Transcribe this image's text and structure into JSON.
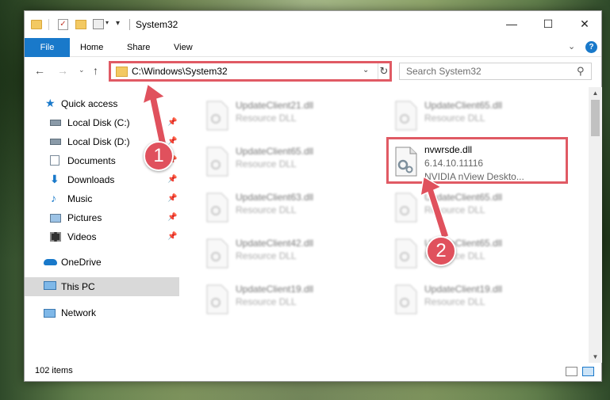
{
  "window": {
    "title": "System32",
    "minimize_glyph": "—",
    "maximize_glyph": "☐",
    "close_glyph": "✕"
  },
  "quick_access_toolbar": {
    "check_glyph": "✓",
    "caret_glyph": "▾",
    "drop_glyph": "▾"
  },
  "ribbon": {
    "tabs": [
      "File",
      "Home",
      "Share",
      "View"
    ],
    "collapse_glyph": "⌄",
    "help_glyph": "?"
  },
  "navigation": {
    "back_glyph": "←",
    "forward_glyph": "→",
    "recent_glyph": "⌄",
    "up_glyph": "↑",
    "address": "C:\\Windows\\System32",
    "address_dropdown_glyph": "⌄",
    "refresh_glyph": "↻",
    "search_placeholder": "Search System32",
    "search_glyph": "⚲"
  },
  "sidebar": {
    "pin_glyph": "📌",
    "items": [
      {
        "label": "Quick access",
        "icon": "star-icon",
        "pinned": false
      },
      {
        "label": "Local Disk (C:)",
        "icon": "drive-icon",
        "pinned": true
      },
      {
        "label": "Local Disk (D:)",
        "icon": "drive-icon",
        "pinned": true
      },
      {
        "label": "Documents",
        "icon": "documents-icon",
        "pinned": true
      },
      {
        "label": "Downloads",
        "icon": "download-icon",
        "pinned": true
      },
      {
        "label": "Music",
        "icon": "music-icon",
        "pinned": true
      },
      {
        "label": "Pictures",
        "icon": "pictures-icon",
        "pinned": true
      },
      {
        "label": "Videos",
        "icon": "videos-icon",
        "pinned": true
      },
      {
        "label": "OneDrive",
        "icon": "cloud-icon",
        "pinned": false
      },
      {
        "label": "This PC",
        "icon": "computer-icon",
        "pinned": false,
        "selected": true
      },
      {
        "label": "Network",
        "icon": "network-icon",
        "pinned": false
      }
    ]
  },
  "files": {
    "left_column": [
      {
        "name": "UpdateClient21.dll",
        "desc": "Resource DLL"
      },
      {
        "name": "UpdateClient65.dll",
        "desc": "Resource DLL"
      },
      {
        "name": "UpdateClient63.dll",
        "desc": "Resource DLL"
      },
      {
        "name": "UpdateClient42.dll",
        "desc": "Resource DLL"
      },
      {
        "name": "UpdateClient19.dll",
        "desc": "Resource DLL"
      }
    ],
    "right_column": [
      {
        "name": "UpdateClient65.dll",
        "desc": "Resource DLL"
      },
      {
        "name": "UpdateClient65.dll",
        "desc": "Resource DLL"
      },
      {
        "name": "UpdateClient65.dll",
        "desc": "Resource DLL"
      },
      {
        "name": "UpdateClient19.dll",
        "desc": "Resource DLL"
      }
    ],
    "highlighted": {
      "name": "nvwrsde.dll",
      "version": "6.14.10.11116",
      "description": "NVIDIA nView Deskto..."
    }
  },
  "scrollbar": {
    "up_glyph": "▲",
    "down_glyph": "▼"
  },
  "status": {
    "item_count": "102 items"
  },
  "callouts": {
    "one": "1",
    "two": "2"
  },
  "colors": {
    "accent": "#1979ca",
    "highlight": "#e05a64",
    "selected_bg": "#d9d9d9"
  }
}
